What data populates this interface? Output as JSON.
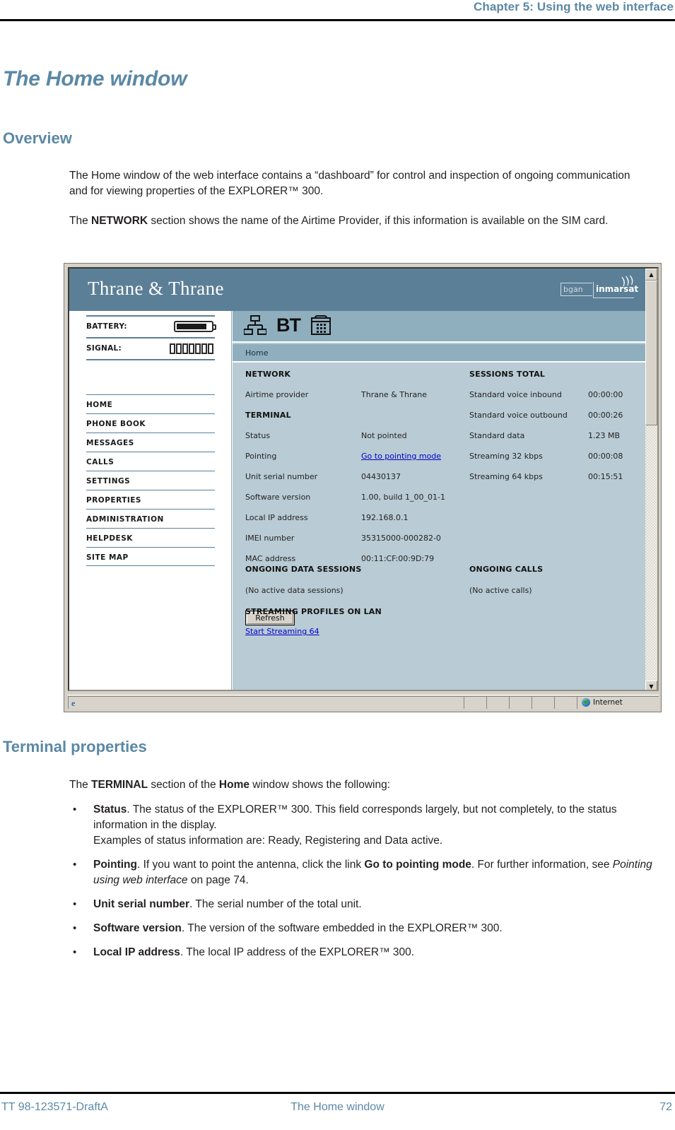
{
  "page": {
    "running_head": "Chapter 5: Using the web interface",
    "title": "The Home window",
    "section_overview": "Overview",
    "section_terminal": "Terminal properties"
  },
  "overview": {
    "paragraph1": "The Home window of the web interface contains a “dashboard” for control and inspection of ongoing communication and for viewing properties of the EXPLORER™ 300.",
    "paragraph2_pre": "The ",
    "paragraph2_bold": "NETWORK",
    "paragraph2_post": " section shows the name of the Airtime Provider, if this information is available on the SIM card."
  },
  "screenshot": {
    "brand": "Thrane & Thrane",
    "logo_bgan": "bgan",
    "logo_inmarsat": "inmarsat",
    "breadcrumb": "Home",
    "icons": {
      "lan": "lan-network-icon",
      "bt": "BT",
      "phone": "phone-keypad-icon"
    },
    "status": {
      "battery_label": "BATTERY:",
      "signal_label": "SIGNAL:",
      "signal_bars": 7
    },
    "nav_items": [
      "HOME",
      "PHONE BOOK",
      "MESSAGES",
      "CALLS",
      "SETTINGS",
      "PROPERTIES",
      "ADMINISTRATION",
      "HELPDESK",
      "SITE MAP"
    ],
    "network": {
      "heading": "NETWORK",
      "rows": [
        {
          "label": "Airtime provider",
          "value": "Thrane & Thrane"
        }
      ]
    },
    "terminal": {
      "heading": "TERMINAL",
      "rows": [
        {
          "label": "Status",
          "value": "Not pointed"
        },
        {
          "label": "Pointing",
          "value": "Go to pointing mode",
          "link": true
        },
        {
          "label": "Unit serial number",
          "value": "04430137"
        },
        {
          "label": "Software version",
          "value": "1.00, build 1_00_01-1"
        },
        {
          "label": "Local IP address",
          "value": "192.168.0.1"
        },
        {
          "label": "IMEI number",
          "value": "35315000-000282-0"
        },
        {
          "label": "MAC address",
          "value": "00:11:CF:00:9D:79"
        }
      ]
    },
    "sessions_total": {
      "heading": "SESSIONS TOTAL",
      "rows": [
        {
          "label": "Standard voice inbound",
          "value": "00:00:00"
        },
        {
          "label": "Standard voice outbound",
          "value": "00:00:26"
        },
        {
          "label": "Standard data",
          "value": "1.23 MB"
        },
        {
          "label": "Streaming 32 kbps",
          "value": "00:00:08"
        },
        {
          "label": "Streaming 64 kbps",
          "value": "00:15:51"
        }
      ]
    },
    "ongoing_data_sessions": {
      "heading": "ONGOING DATA SESSIONS",
      "empty_text": "(No active data sessions)"
    },
    "ongoing_calls": {
      "heading": "ONGOING CALLS",
      "empty_text": "(No active calls)"
    },
    "streaming_profiles": {
      "heading": "STREAMING PROFILES ON LAN",
      "link": "Start Streaming 64"
    },
    "refresh_button": "Refresh",
    "status_bar": {
      "zone": "Internet"
    },
    "colors": {
      "banner": "#5b7f96",
      "content": "#b9cbd4",
      "iconbar": "#8fafbe",
      "link": "#0000cc"
    }
  },
  "terminal_properties": {
    "lead_pre": "The ",
    "lead_b1": "TERMINAL",
    "lead_mid": " section of the ",
    "lead_b2": "Home",
    "lead_post": " window shows the following:",
    "bullets": [
      {
        "bold": "Status",
        "text": ". The status of the EXPLORER™ 300. This field corresponds largely, but not completely, to the status information in the display.",
        "extra_line": "Examples of status information are: Ready, Registering and Data active."
      },
      {
        "bold": "Pointing",
        "text": ". If you want to point the antenna, click the link ",
        "bold2": "Go to pointing mode",
        "text2": ". For further information, see ",
        "italic": "Pointing using web interface",
        "text3": " on page 74."
      },
      {
        "bold": "Unit serial number",
        "text": ". The serial number of the total unit."
      },
      {
        "bold": "Software version",
        "text": ". The version of the software embedded in the EXPLORER™ 300."
      },
      {
        "bold": "Local IP address",
        "text": ". The local IP address of the EXPLORER™ 300."
      }
    ]
  },
  "footer": {
    "left": "TT 98-123571-DraftA",
    "center": "The Home window",
    "right": "72"
  }
}
